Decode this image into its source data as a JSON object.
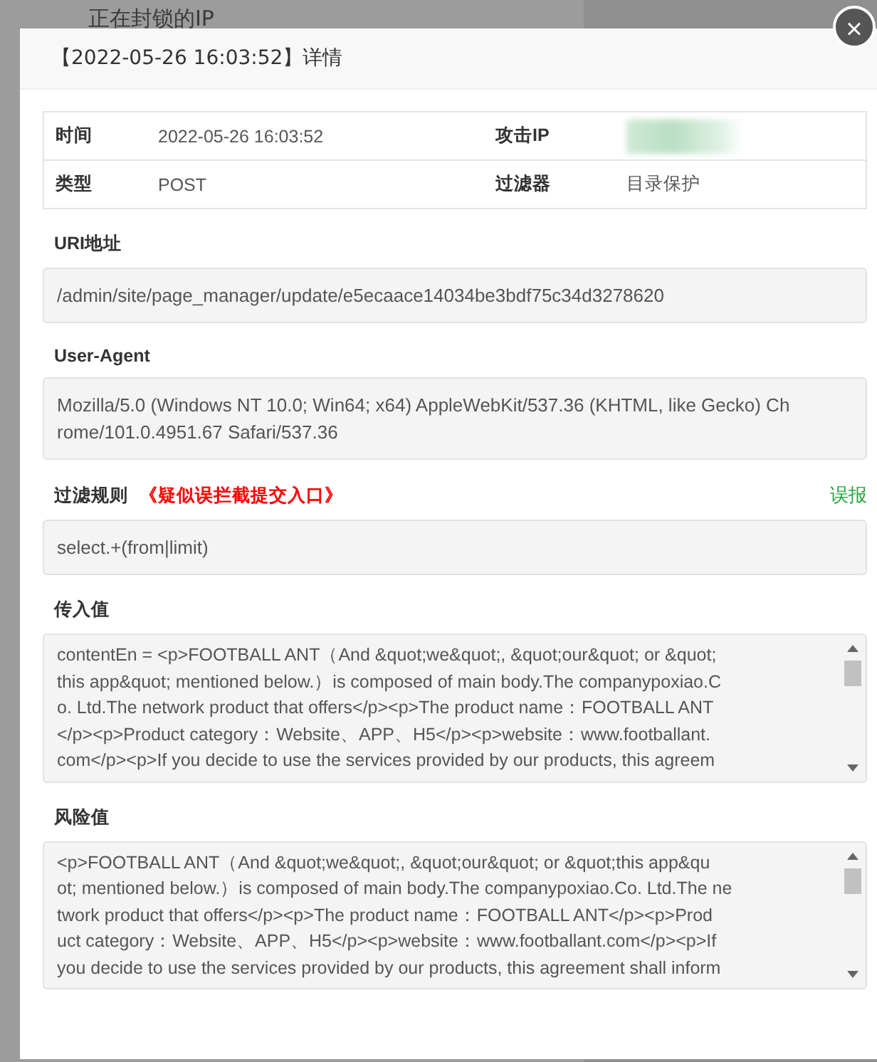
{
  "background_page": {
    "heading": "正在封锁的IP"
  },
  "dialog": {
    "title": "【2022-05-26 16:03:52】详情",
    "close_label": "×"
  },
  "info_table": {
    "rows": [
      {
        "cells": [
          {
            "label": "时间",
            "value": "2022-05-26 16:03:52",
            "kind": "text"
          },
          {
            "label": "攻击IP",
            "kind": "redacted"
          }
        ]
      },
      {
        "cells": [
          {
            "label": "类型",
            "value": "POST",
            "kind": "text"
          },
          {
            "label": "过滤器",
            "value": "目录保护",
            "kind": "text"
          }
        ]
      }
    ]
  },
  "sections": [
    {
      "label": "URI地址",
      "kind": "plain",
      "lines": [
        "/admin/site/page_manager/update/e5ecaace14034be3bdf75c34d3278620"
      ]
    },
    {
      "label": "User-Agent",
      "kind": "plain",
      "lines": [
        "Mozilla/5.0 (Windows NT 10.0; Win64; x64) AppleWebKit/537.36 (KHTML, like Gecko) Ch",
        "rome/101.0.4951.67 Safari/537.36"
      ]
    },
    {
      "label": "过滤规则",
      "note": "《疑似误拦截提交入口》",
      "action": "误报",
      "kind": "plain",
      "lines": [
        "select.+(from|limit)"
      ]
    },
    {
      "label": "传入值",
      "kind": "scroll",
      "lines": [
        "contentEn = <p>FOOTBALL ANT（And &quot;we&quot;, &quot;our&quot; or &quot;",
        "this app&quot; mentioned below.）is composed of main body.The companypoxiao.C",
        "o. Ltd.The network product that offers</p><p>The product name：FOOTBALL ANT",
        "</p><p>Product category：Website、APP、H5</p><p>website：www.footballant.",
        "com</p><p>If you decide to use the services provided by our products, this agreem"
      ]
    },
    {
      "label": "风险值",
      "kind": "scroll",
      "lines": [
        "<p>FOOTBALL ANT（And &quot;we&quot;, &quot;our&quot; or &quot;this app&qu",
        "ot; mentioned below.）is composed of main body.The companypoxiao.Co. Ltd.The ne",
        "twork product that offers</p><p>The product name：FOOTBALL ANT</p><p>Prod",
        "uct category：Website、APP、H5</p><p>website：www.footballant.com</p><p>If",
        "you decide to use the services provided by our products, this agreement shall inform"
      ]
    }
  ]
}
